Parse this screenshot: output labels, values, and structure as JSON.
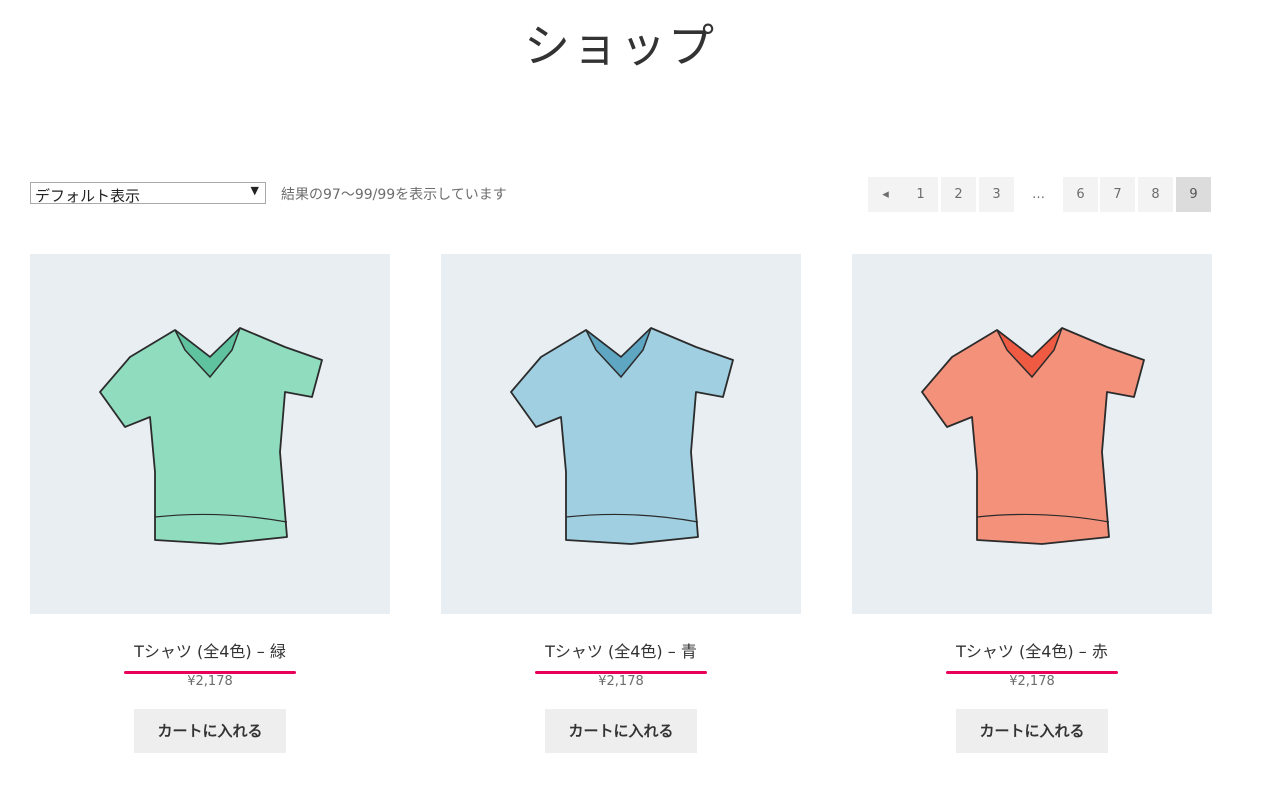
{
  "page": {
    "title": "ショップ"
  },
  "toolbar": {
    "sort_selected": "デフォルト表示",
    "result_count": "結果の97〜99/99を表示しています"
  },
  "pagination": {
    "prev": "◂",
    "pages": [
      "1",
      "2",
      "3",
      "…",
      "6",
      "7",
      "8",
      "9"
    ],
    "current": "9"
  },
  "products": [
    {
      "name": "Tシャツ (全4色) – 緑",
      "price": "¥2,178",
      "button": "カートに入れる",
      "color": "#8fdcbf",
      "shade": "#5fc3a0"
    },
    {
      "name": "Tシャツ (全4色) – 青",
      "price": "¥2,178",
      "button": "カートに入れる",
      "color": "#9fcfe0",
      "shade": "#5ea6c2"
    },
    {
      "name": "Tシャツ (全4色) – 赤",
      "price": "¥2,178",
      "button": "カートに入れる",
      "color": "#f4917b",
      "shade": "#ee5b42"
    }
  ]
}
